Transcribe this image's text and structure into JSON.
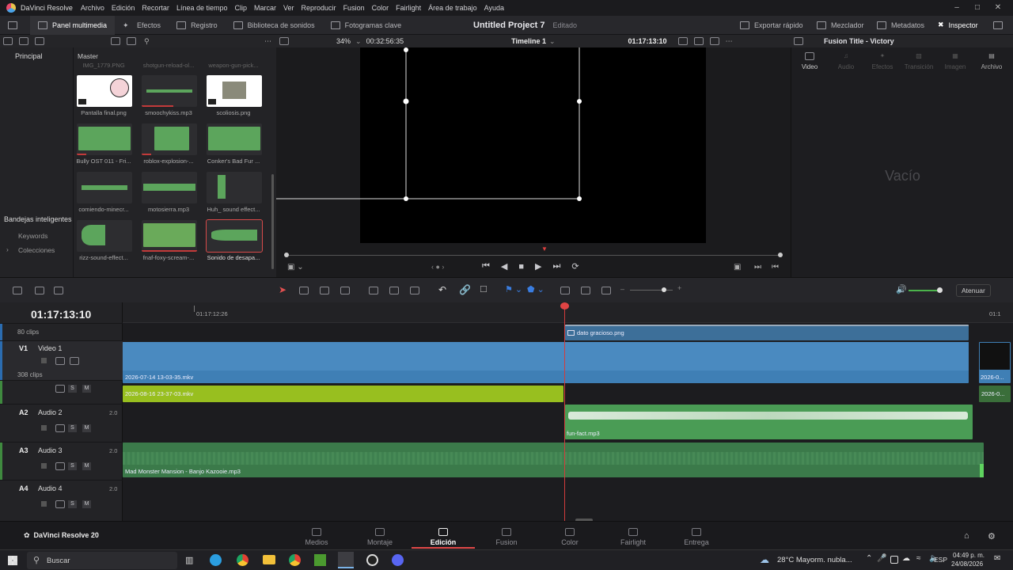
{
  "window": {
    "app_name": "DaVinci Resolve",
    "menu": [
      "Archivo",
      "Edición",
      "Recortar",
      "Línea de tiempo",
      "Clip",
      "Marcar",
      "Ver",
      "Reproducir",
      "Fusion",
      "Color",
      "Fairlight",
      "Área de trabajo",
      "Ayuda"
    ]
  },
  "toolbar": {
    "panel_multimedia": "Panel multimedia",
    "efectos": "Efectos",
    "registro": "Registro",
    "biblioteca": "Biblioteca de sonidos",
    "fotogramas": "Fotogramas clave",
    "project_title": "Untitled Project 7",
    "project_status": "Editado",
    "exportar": "Exportar rápido",
    "mezclador": "Mezclador",
    "metadatos": "Metadatos",
    "inspector": "Inspector"
  },
  "subbar": {
    "zoom": "34%",
    "duration": "00:32:56:35",
    "timeline_name": "Timeline 1",
    "timecode": "01:17:13:10",
    "inspector_title": "Fusion Title - Victory"
  },
  "left_panel": {
    "principal": "Principal",
    "bandejas": "Bandejas inteligentes",
    "keywords": "Keywords",
    "colecciones": "Colecciones"
  },
  "media_pool": {
    "master": "Master",
    "top_row": [
      "IMG_1779.PNG",
      "shotgun-reload-ol...",
      "weapon-gun-pick..."
    ],
    "items": [
      {
        "label": "Pantalla final.png",
        "kind": "image"
      },
      {
        "label": "smoochykiss.mp3",
        "kind": "audio"
      },
      {
        "label": "scoliosis.png",
        "kind": "image"
      },
      {
        "label": "Bully OST 011 - Fri...",
        "kind": "audio"
      },
      {
        "label": "roblox-explosion-...",
        "kind": "audio"
      },
      {
        "label": "Conker's Bad Fur ...",
        "kind": "audio"
      },
      {
        "label": "comiendo-minecr...",
        "kind": "audio"
      },
      {
        "label": "motosierra.mp3",
        "kind": "audio"
      },
      {
        "label": "Huh_ sound effect...",
        "kind": "audio"
      },
      {
        "label": "rizz-sound-effect...",
        "kind": "audio"
      },
      {
        "label": "fnaf-foxy-scream-...",
        "kind": "audio"
      },
      {
        "label": "Sonido de desapa...",
        "kind": "audio"
      }
    ]
  },
  "inspector": {
    "tabs": [
      "Video",
      "Audio",
      "Efectos",
      "Transición",
      "Imagen",
      "Archivo"
    ],
    "empty": "Vacío"
  },
  "timeline_toolbar": {
    "atenuar": "Atenuar"
  },
  "timeline": {
    "timecode": "01:17:13:10",
    "ruler_label": "01:17:12:26",
    "ruler_right": "01:1",
    "tracks": [
      {
        "id": "",
        "name": "",
        "info": "80 clips"
      },
      {
        "id": "V1",
        "name": "Video 1",
        "info": "308 clips"
      },
      {
        "id": "A2",
        "name": "Audio 2",
        "level": "2.0"
      },
      {
        "id": "A3",
        "name": "Audio 3",
        "level": "2.0"
      },
      {
        "id": "A4",
        "name": "Audio 4",
        "level": "2.0"
      }
    ],
    "s_label": "S",
    "m_label": "M",
    "clips": {
      "dato": "dato gracioso.png",
      "v1_main": "2026-07-14 13-03-35.mkv",
      "v1_tail": "2026-0...",
      "a1_main": "2026-08-16 23-37-03.mkv",
      "a1_tail": "2026-0...",
      "a2": "fun-fact.mp3",
      "a3": "Mad Monster Mansion - Banjo Kazooie.mp3"
    }
  },
  "pages": {
    "brand": "DaVinci Resolve 20",
    "items": [
      "Medios",
      "Montaje",
      "Edición",
      "Fusion",
      "Color",
      "Fairlight",
      "Entrega"
    ],
    "active": "Edición"
  },
  "taskbar": {
    "search": "Buscar",
    "weather": "28°C  Mayorm. nubla...",
    "lang": "ESP",
    "time": "04:49 p. m.",
    "date": "24/08/2026"
  }
}
